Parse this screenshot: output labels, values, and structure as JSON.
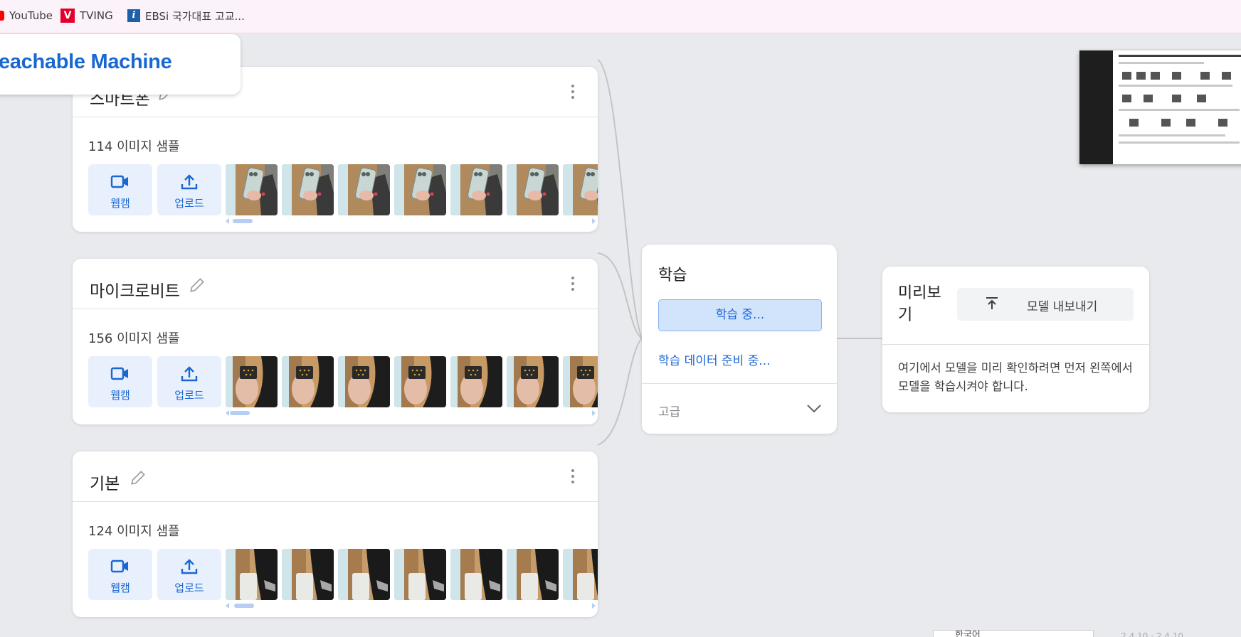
{
  "bookmarks": [
    {
      "label": "YouTube",
      "icon": "youtube-icon"
    },
    {
      "label": "TVING",
      "icon": "tving-icon"
    },
    {
      "label": "EBSi 국가대표 고교...",
      "icon": "ebsi-icon"
    }
  ],
  "brand": {
    "title": "eachable Machine"
  },
  "classes": [
    {
      "name": "스마트폰",
      "samples": "114 이미지 샘플",
      "webcam": "웹캠",
      "upload": "업로드",
      "thumb_subject": "smartphone"
    },
    {
      "name": "마이크로비트",
      "samples": "156 이미지 샘플",
      "webcam": "웹캠",
      "upload": "업로드",
      "thumb_subject": "microbit"
    },
    {
      "name": "기본",
      "samples": "124 이미지 샘플",
      "webcam": "웹캠",
      "upload": "업로드",
      "thumb_subject": "empty"
    }
  ],
  "training": {
    "title": "학습",
    "button": "학습 중...",
    "status": "학습 데이터 준비 중...",
    "advanced": "고급"
  },
  "preview": {
    "title": "미리보기",
    "export_button": "모델 내보내기",
    "description": "여기에서 모델을 미리 확인하려면 먼저 왼쪽에서 모델을 학습시켜야 합니다."
  },
  "footer": {
    "language": "한국어",
    "version": "... 2.4.10 · 2.4.10"
  },
  "colors": {
    "accent": "#1967d2",
    "accent_light": "#e8f0fe",
    "bg": "#e8eaed",
    "bookmark_bar": "#fcf3fa"
  }
}
